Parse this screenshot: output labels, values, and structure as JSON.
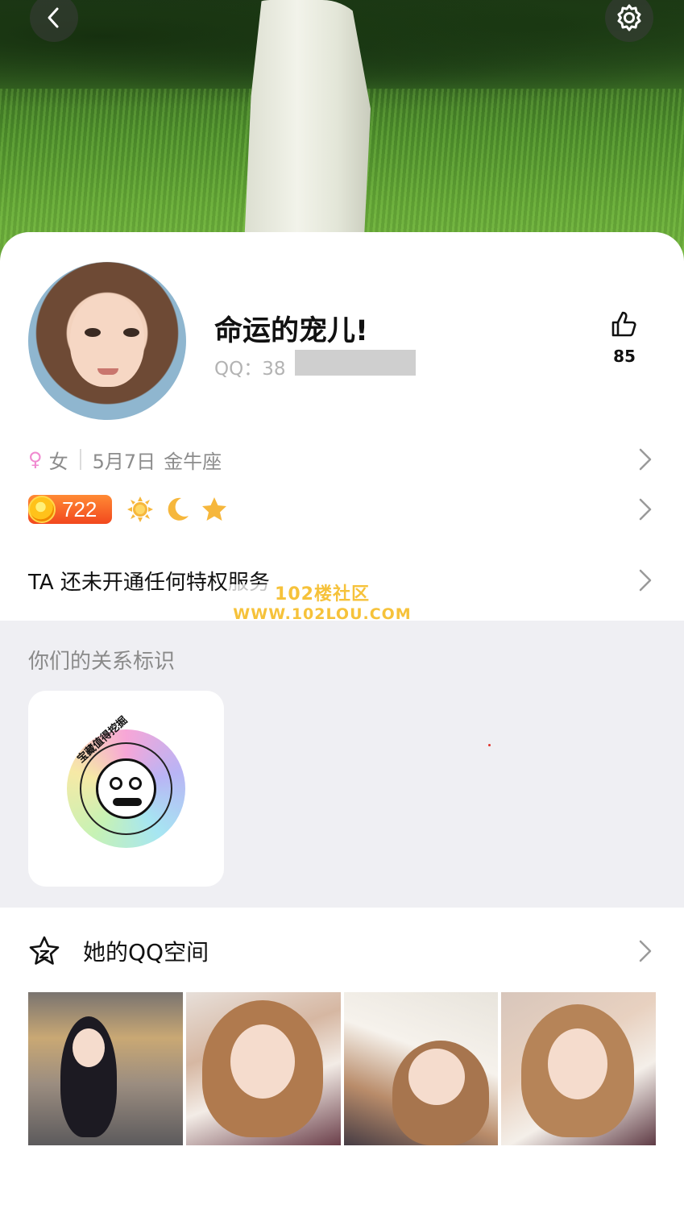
{
  "header": {
    "back_icon": "chevron-left-icon",
    "settings_icon": "gear-icon"
  },
  "profile": {
    "nickname": "命运的宠儿!",
    "qq_label": "QQ：38",
    "qq_masked": true,
    "likes": "85",
    "like_icon": "thumbs-up-icon"
  },
  "info": {
    "gender_symbol": "♀",
    "gender": "女",
    "birthday": "5月7日",
    "zodiac": "金牛座"
  },
  "level": {
    "number": "722",
    "badges": [
      "sun-icon",
      "moon-icon",
      "star-icon"
    ]
  },
  "privilege": {
    "text": "TA 还未开通任何特权服务"
  },
  "watermark": {
    "line1": "102楼社区",
    "line2": "WWW.102LOU.COM"
  },
  "relation": {
    "title": "你们的关系标识",
    "badge_text": "宝藏值得挖掘"
  },
  "space": {
    "label": "她的QQ空间",
    "icon": "star-outline-icon",
    "photos": [
      "photo-1",
      "photo-2",
      "photo-3",
      "photo-4"
    ]
  },
  "colors": {
    "level_pill": "#f2481e",
    "gender": "#f08ad0",
    "watermark": "#f6c23a",
    "section_bg": "#efeff3"
  }
}
